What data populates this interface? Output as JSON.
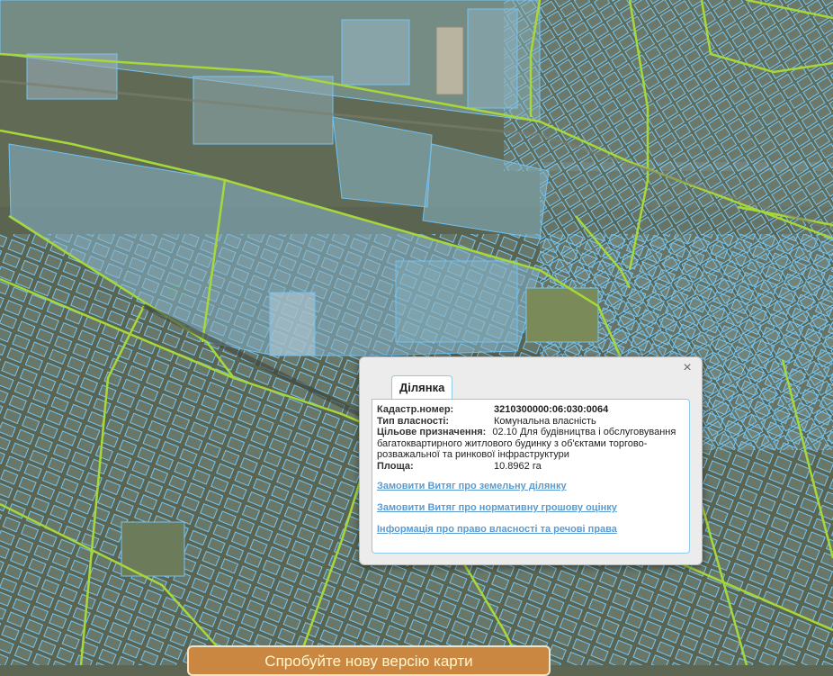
{
  "map": {
    "colors": {
      "parcel_fill": "#8cc8e8",
      "parcel_stroke": "#6ec2f5",
      "boundary": "#a7d83a",
      "aerial": "#5e6650"
    }
  },
  "popup": {
    "tab_label": "Ділянка",
    "close_icon": "×",
    "fields": [
      {
        "label": "Кадастр.номер:",
        "value": "3210300000:06:030:0064"
      },
      {
        "label": "Тип власності:",
        "value": "Комунальна власність"
      }
    ],
    "purpose": {
      "label": "Цільове призначення:",
      "value": "02.10 Для будівництва і обслуговування багатоквартирного житлового будинку з об'єктами торгово-розважальної та ринкової інфраструктури"
    },
    "area": {
      "label": "Площа:",
      "value": "10.8962 га"
    },
    "links": [
      "Замовити Витяг про земельну ділянку",
      "Замовити Витяг про нормативну грошову оцінку",
      "Інформація про право власності та речові права"
    ]
  },
  "banner": {
    "label": "Спробуйте нову версію карти"
  }
}
